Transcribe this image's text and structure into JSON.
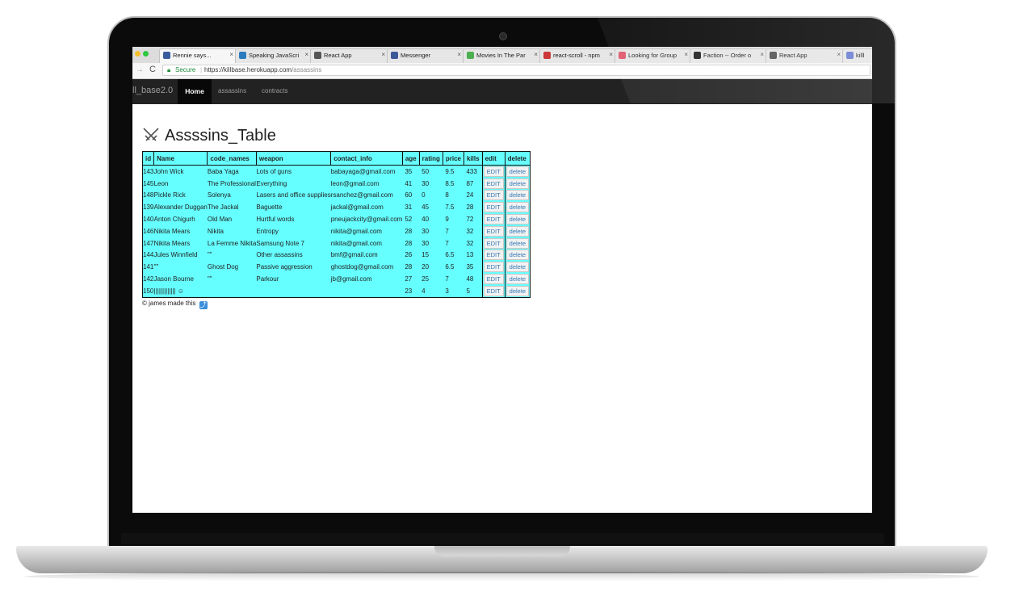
{
  "browser": {
    "tabs": [
      {
        "label": "Rennie says...",
        "icon": "bitly-icon",
        "color": "#3a5b9d"
      },
      {
        "label": "Speaking JavaScri",
        "icon": "book-icon",
        "color": "#2c7bbf"
      },
      {
        "label": "React App",
        "icon": "react-icon",
        "color": "#555555"
      },
      {
        "label": "Messenger",
        "icon": "facebook-icon",
        "color": "#3b5998"
      },
      {
        "label": "Movies In The Par",
        "icon": "movies-icon",
        "color": "#4caf50"
      },
      {
        "label": "react-scroll - npm",
        "icon": "npm-icon",
        "color": "#cb3837"
      },
      {
        "label": "Looking for Group",
        "icon": "lfg-icon",
        "color": "#e05a6d"
      },
      {
        "label": "Faction -- Order o",
        "icon": "faction-icon",
        "color": "#222222"
      },
      {
        "label": "React App",
        "icon": "react-icon",
        "color": "#555555"
      },
      {
        "label": "killbas",
        "icon": "killbase-icon",
        "color": "#6a7fd1"
      }
    ],
    "secure_label": "Secure",
    "url_scheme": "https://",
    "url_host": "killbase.herokuapp.com",
    "url_path": "/assassins"
  },
  "navbar": {
    "brand": "ll_base2.0",
    "home": "Home",
    "assassins": "assassins",
    "contracts": "contracts"
  },
  "page": {
    "title": "Assssins_Table",
    "footer": "© james made this"
  },
  "table": {
    "headers": [
      "id",
      "Name",
      "code_names",
      "weapon",
      "contact_info",
      "age",
      "rating",
      "price",
      "kills",
      "edit",
      "delete"
    ],
    "edit_label": "EDIT",
    "delete_label": "delete",
    "rows": [
      {
        "id": "143",
        "name": "John Wick",
        "code": "Baba Yaga",
        "weapon": "Lots of guns",
        "contact": "babayaga@gmail.com",
        "age": "35",
        "rating": "50",
        "price": "9.5",
        "kills": "433"
      },
      {
        "id": "145",
        "name": "Leon",
        "code": "The Professional",
        "weapon": "Everything",
        "contact": "leon@gmail.com",
        "age": "41",
        "rating": "30",
        "price": "8.5",
        "kills": "87"
      },
      {
        "id": "148",
        "name": "Pickle Rick",
        "code": "Solenya",
        "weapon": "Lasers and office supplies",
        "contact": "rsanchez@gmail.com",
        "age": "60",
        "rating": "0",
        "price": "8",
        "kills": "24"
      },
      {
        "id": "139",
        "name": "Alexander Duggan",
        "code": "The Jackal",
        "weapon": "Baguette",
        "contact": "jackal@gmail.com",
        "age": "31",
        "rating": "45",
        "price": "7.5",
        "kills": "28"
      },
      {
        "id": "140",
        "name": "Anton Chigurh",
        "code": "Old Man",
        "weapon": "Hurtful words",
        "contact": "pneujackcity@gmail.com",
        "age": "52",
        "rating": "40",
        "price": "9",
        "kills": "72"
      },
      {
        "id": "146",
        "name": "Nikita Mears",
        "code": "Nikita",
        "weapon": "Entropy",
        "contact": "nikita@gmail.com",
        "age": "28",
        "rating": "30",
        "price": "7",
        "kills": "32"
      },
      {
        "id": "147",
        "name": "Nikita Mears",
        "code": "La Femme Nikita",
        "weapon": "Samsung Note 7",
        "contact": "nikita@gmail.com",
        "age": "28",
        "rating": "30",
        "price": "7",
        "kills": "32"
      },
      {
        "id": "144",
        "name": "Jules Winnfield",
        "code": "\"\"",
        "weapon": "Other assassins",
        "contact": "bmf@gmail.com",
        "age": "26",
        "rating": "15",
        "price": "6.5",
        "kills": "13"
      },
      {
        "id": "141",
        "name": "\"\"",
        "code": "Ghost Dog",
        "weapon": "Passive aggression",
        "contact": "ghostdog@gmail.com",
        "age": "28",
        "rating": "20",
        "price": "6.5",
        "kills": "35"
      },
      {
        "id": "142",
        "name": "Jason Bourne",
        "code": "\"\"",
        "weapon": "Parkour",
        "contact": "jb@gmail.com",
        "age": "27",
        "rating": "25",
        "price": "7",
        "kills": "48"
      },
      {
        "id": "150",
        "name": "||||||||||||| ☺",
        "code": "",
        "weapon": "",
        "contact": "",
        "age": "23",
        "rating": "4",
        "price": "3",
        "kills": "5"
      }
    ]
  },
  "colors": {
    "table_bg": "#66ffff",
    "navbar_bg": "#222222",
    "link": "#337ab7"
  }
}
